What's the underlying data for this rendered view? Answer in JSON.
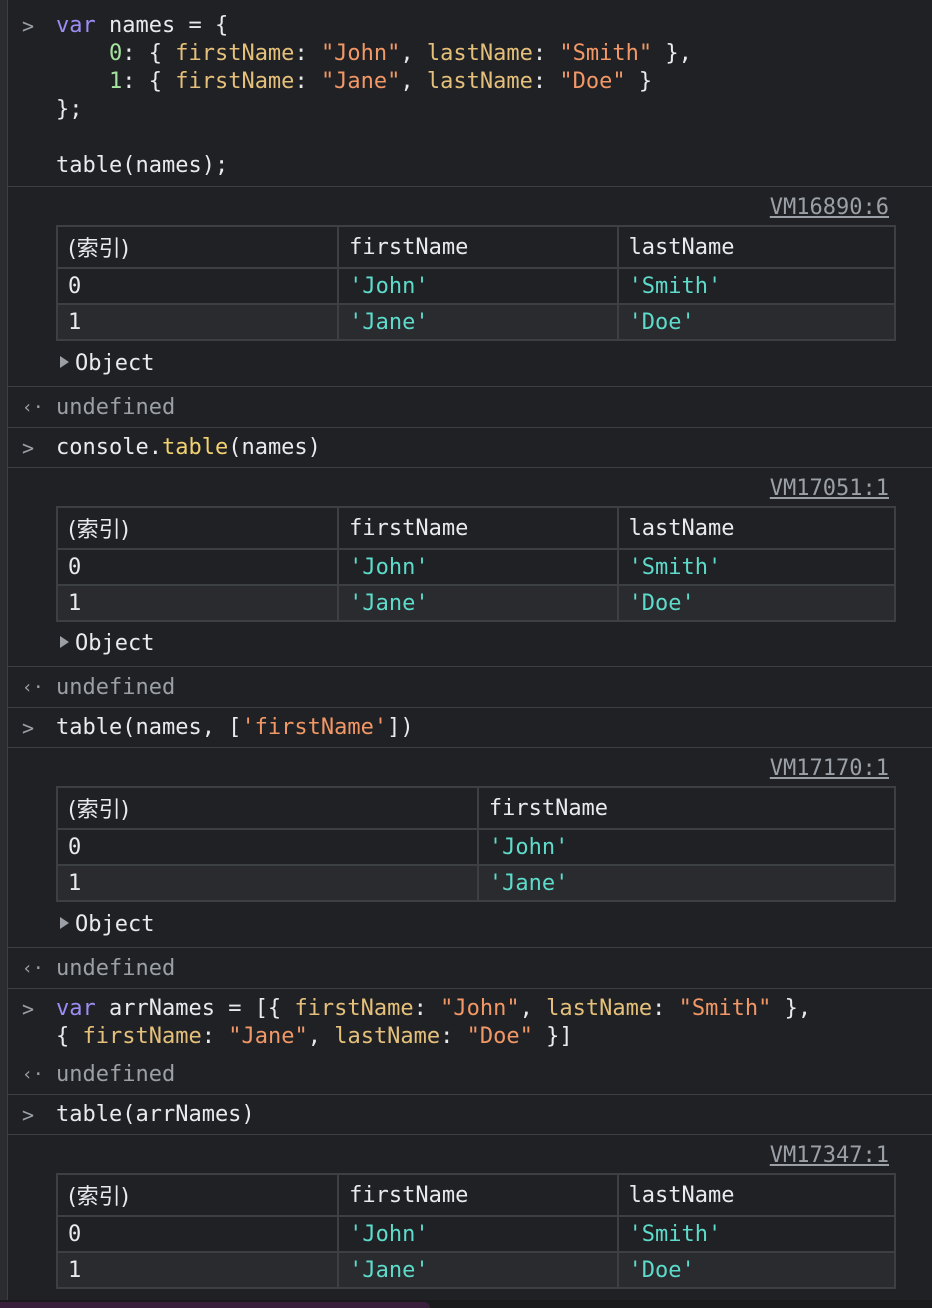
{
  "entries": {
    "e1": {
      "code_lines": [
        "var names = {",
        "    0: { firstName: \"John\", lastName: \"Smith\" },",
        "    1: { firstName: \"Jane\", lastName: \"Doe\" }",
        "};",
        "",
        "table(names);"
      ],
      "source_link": "VM16890:6",
      "table": {
        "headers": [
          "(索引)",
          "firstName",
          "lastName"
        ],
        "rows": [
          [
            "0",
            "'John'",
            "'Smith'"
          ],
          [
            "1",
            "'Jane'",
            "'Doe'"
          ]
        ]
      },
      "object_label": "Object",
      "result": "undefined"
    },
    "e2": {
      "code": "console.table(names)",
      "source_link": "VM17051:1",
      "table": {
        "headers": [
          "(索引)",
          "firstName",
          "lastName"
        ],
        "rows": [
          [
            "0",
            "'John'",
            "'Smith'"
          ],
          [
            "1",
            "'Jane'",
            "'Doe'"
          ]
        ]
      },
      "object_label": "Object",
      "result": "undefined"
    },
    "e3": {
      "code": "table(names, ['firstName'])",
      "source_link": "VM17170:1",
      "table": {
        "headers": [
          "(索引)",
          "firstName"
        ],
        "rows": [
          [
            "0",
            "'John'"
          ],
          [
            "1",
            "'Jane'"
          ]
        ]
      },
      "object_label": "Object",
      "result": "undefined"
    },
    "e4": {
      "code_lines": [
        "var arrNames = [{ firstName: \"John\", lastName: \"Smith\" },",
        "{ firstName: \"Jane\", lastName: \"Doe\" }]"
      ],
      "result": "undefined"
    },
    "e5": {
      "code": "table(arrNames)",
      "source_link": "VM17347:1",
      "table": {
        "headers": [
          "(索引)",
          "firstName",
          "lastName"
        ],
        "rows": [
          [
            "0",
            "'John'",
            "'Smith'"
          ],
          [
            "1",
            "'Jane'",
            "'Doe'"
          ]
        ]
      }
    }
  },
  "glyphs": {
    "input_prompt": ">",
    "return_marker": "‹·"
  },
  "colors": {
    "background": "#202124",
    "keyword": "#9b8df5",
    "property": "#e5c07b",
    "string": "#f29766",
    "table_value": "#5ddbcb",
    "muted": "#9aa0a6"
  }
}
